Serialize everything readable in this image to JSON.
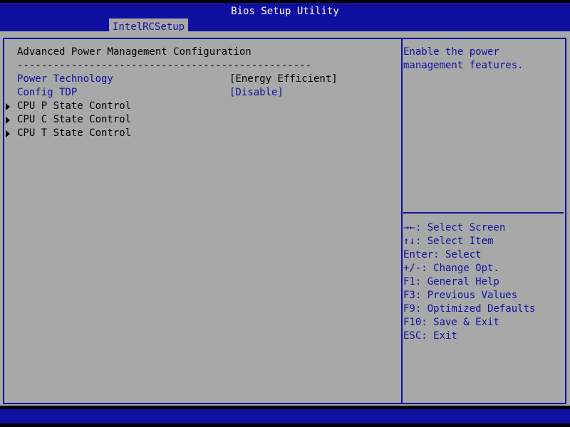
{
  "header": {
    "title": "Bios Setup Utility",
    "tab_label": "IntelRCSetup"
  },
  "left_panel": {
    "section_title": "Advanced Power Management Configuration",
    "separator": "-------------------------------------------------",
    "settings": [
      {
        "label": "Power Technology",
        "value": "[Energy Efficient]"
      },
      {
        "label": "Config TDP",
        "value": "[Disable]"
      }
    ],
    "submenus": [
      {
        "label": "CPU P State Control"
      },
      {
        "label": "CPU C State Control"
      },
      {
        "label": "CPU T State Control"
      }
    ]
  },
  "right_panel": {
    "help_lines": [
      "Enable the power",
      "management features."
    ],
    "keys": [
      "→←: Select Screen",
      "↑↓: Select Item",
      "Enter: Select",
      "+/-: Change Opt.",
      "F1: General Help",
      "F3: Previous Values",
      "F9: Optimized Defaults",
      "F10: Save & Exit",
      "ESC: Exit"
    ]
  },
  "colors": {
    "bios_blue": "#1010A0",
    "panel_gray": "#A8A8A8",
    "title_text": "#FFFFFF"
  }
}
